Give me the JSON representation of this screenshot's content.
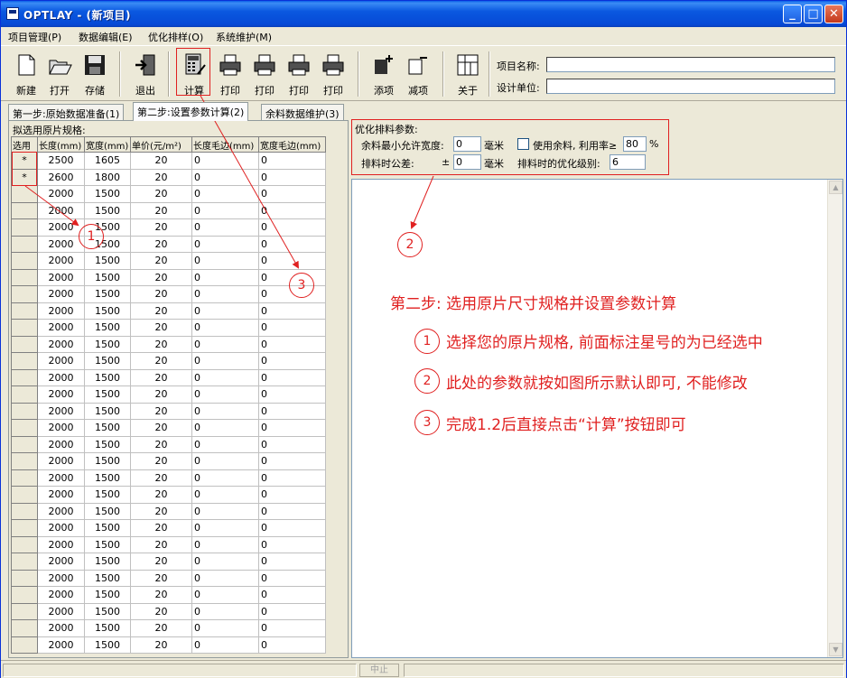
{
  "window": {
    "title": "OPTLAY - (新项目)",
    "controls": [
      "_",
      "□",
      "✕"
    ]
  },
  "menu": [
    "项目管理(P)",
    "数据编辑(E)",
    "优化排样(O)",
    "系统维护(M)"
  ],
  "toolbar": {
    "buttons": [
      "新建",
      "打开",
      "存储",
      "退出",
      "计算",
      "打印",
      "打印",
      "打印",
      "打印",
      "添项",
      "减项",
      "关于"
    ],
    "project_name_label": "项目名称:",
    "project_name_value": "",
    "design_unit_label": "设计单位:",
    "design_unit_value": ""
  },
  "tabs": [
    "第一步:原始数据准备(1)",
    "第二步:设置参数计算(2)",
    "余料数据维护(3)"
  ],
  "left_panel": {
    "title": "拟选用原片规格:",
    "columns": [
      "选用",
      "长度(mm)",
      "宽度(mm)",
      "单价(元/m²)",
      "长度毛边(mm)",
      "宽度毛边(mm)"
    ],
    "rows": [
      [
        "*",
        "2500",
        "1605",
        "20",
        "0",
        "0"
      ],
      [
        "*",
        "2600",
        "1800",
        "20",
        "0",
        "0"
      ],
      [
        "",
        "2000",
        "1500",
        "20",
        "0",
        "0"
      ],
      [
        "",
        "2000",
        "1500",
        "20",
        "0",
        "0"
      ],
      [
        "",
        "2000",
        "1500",
        "20",
        "0",
        "0"
      ],
      [
        "",
        "2000",
        "1500",
        "20",
        "0",
        "0"
      ],
      [
        "",
        "2000",
        "1500",
        "20",
        "0",
        "0"
      ],
      [
        "",
        "2000",
        "1500",
        "20",
        "0",
        "0"
      ],
      [
        "",
        "2000",
        "1500",
        "20",
        "0",
        "0"
      ],
      [
        "",
        "2000",
        "1500",
        "20",
        "0",
        "0"
      ],
      [
        "",
        "2000",
        "1500",
        "20",
        "0",
        "0"
      ],
      [
        "",
        "2000",
        "1500",
        "20",
        "0",
        "0"
      ],
      [
        "",
        "2000",
        "1500",
        "20",
        "0",
        "0"
      ],
      [
        "",
        "2000",
        "1500",
        "20",
        "0",
        "0"
      ],
      [
        "",
        "2000",
        "1500",
        "20",
        "0",
        "0"
      ],
      [
        "",
        "2000",
        "1500",
        "20",
        "0",
        "0"
      ],
      [
        "",
        "2000",
        "1500",
        "20",
        "0",
        "0"
      ],
      [
        "",
        "2000",
        "1500",
        "20",
        "0",
        "0"
      ],
      [
        "",
        "2000",
        "1500",
        "20",
        "0",
        "0"
      ],
      [
        "",
        "2000",
        "1500",
        "20",
        "0",
        "0"
      ],
      [
        "",
        "2000",
        "1500",
        "20",
        "0",
        "0"
      ],
      [
        "",
        "2000",
        "1500",
        "20",
        "0",
        "0"
      ],
      [
        "",
        "2000",
        "1500",
        "20",
        "0",
        "0"
      ],
      [
        "",
        "2000",
        "1500",
        "20",
        "0",
        "0"
      ],
      [
        "",
        "2000",
        "1500",
        "20",
        "0",
        "0"
      ],
      [
        "",
        "2000",
        "1500",
        "20",
        "0",
        "0"
      ],
      [
        "",
        "2000",
        "1500",
        "20",
        "0",
        "0"
      ],
      [
        "",
        "2000",
        "1500",
        "20",
        "0",
        "0"
      ],
      [
        "",
        "2000",
        "1500",
        "20",
        "0",
        "0"
      ],
      [
        "",
        "2000",
        "1500",
        "20",
        "0",
        "0"
      ]
    ]
  },
  "params": {
    "title": "优化排料参数:",
    "min_width_label": "余料最小允许宽度:",
    "min_width_value": "0",
    "min_width_unit": "毫米",
    "use_remnant_label": "使用余料, 利用率≥",
    "use_remnant_checked": false,
    "utilization_value": "80",
    "utilization_unit": "%",
    "tolerance_label": "排料时公差:",
    "tolerance_prefix": "±",
    "tolerance_value": "0",
    "tolerance_unit": "毫米",
    "level_label": "排料时的优化级别:",
    "level_value": "6"
  },
  "status": {
    "stop_button": "中止"
  },
  "annotations": {
    "markers": [
      "1",
      "2",
      "3",
      "1",
      "2",
      "3"
    ],
    "heading": "第二步: 选用原片尺寸规格并设置参数计算",
    "step1": "选择您的原片规格, 前面标注星号的为已经选中",
    "step2": "此处的参数就按如图所示默认即可, 不能修改",
    "step3": "完成1.2后直接点击“计算”按钮即可"
  },
  "colors": {
    "titlebar": "#0a58e0",
    "annotation": "#e02020",
    "face": "#ece9d8"
  }
}
